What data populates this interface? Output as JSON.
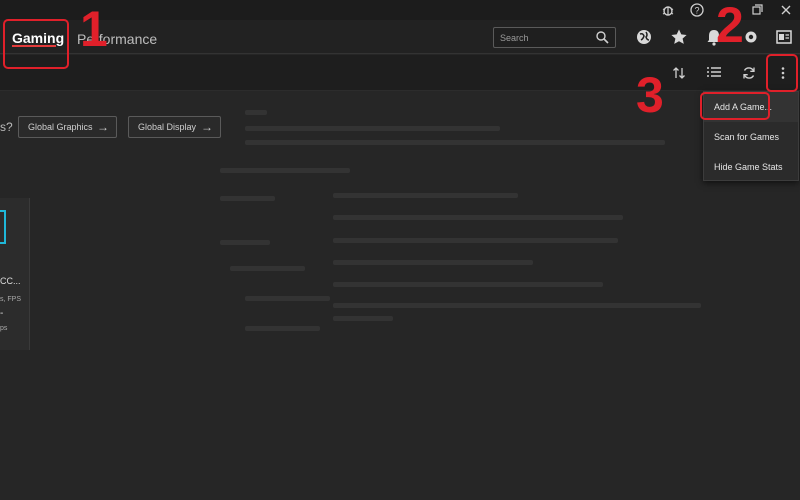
{
  "titlebar": {
    "icons": [
      "bug-icon",
      "help-icon",
      "minimize-icon",
      "maximize-icon",
      "close-icon"
    ]
  },
  "header": {
    "tabs": [
      {
        "label": "Gaming"
      },
      {
        "label": "Performance"
      }
    ],
    "search": {
      "placeholder": "Search"
    },
    "icons": [
      "globe-icon",
      "star-icon",
      "bell-icon",
      "settings-icon",
      "account-icon"
    ]
  },
  "toolbar": {
    "icons": [
      "sort-icon",
      "list-view-icon",
      "refresh-icon",
      "more-options-icon"
    ]
  },
  "content": {
    "question_text": "s?",
    "buttons": [
      {
        "label": "Global Graphics"
      },
      {
        "label": "Global Display"
      }
    ],
    "game_card": {
      "name": "CC...",
      "fps_label": "s, FPS",
      "value": "-",
      "unit": "ps"
    }
  },
  "menu": {
    "items": [
      {
        "label": "Add A Game..."
      },
      {
        "label": "Scan for Games"
      },
      {
        "label": "Hide Game Stats"
      }
    ]
  },
  "annotations": {
    "numbers": [
      "1",
      "2",
      "3"
    ],
    "color": "#e0202a"
  },
  "colors": {
    "accent": "#e23b3b",
    "background": "#262626",
    "card_thumb": "#1fb7d8"
  }
}
